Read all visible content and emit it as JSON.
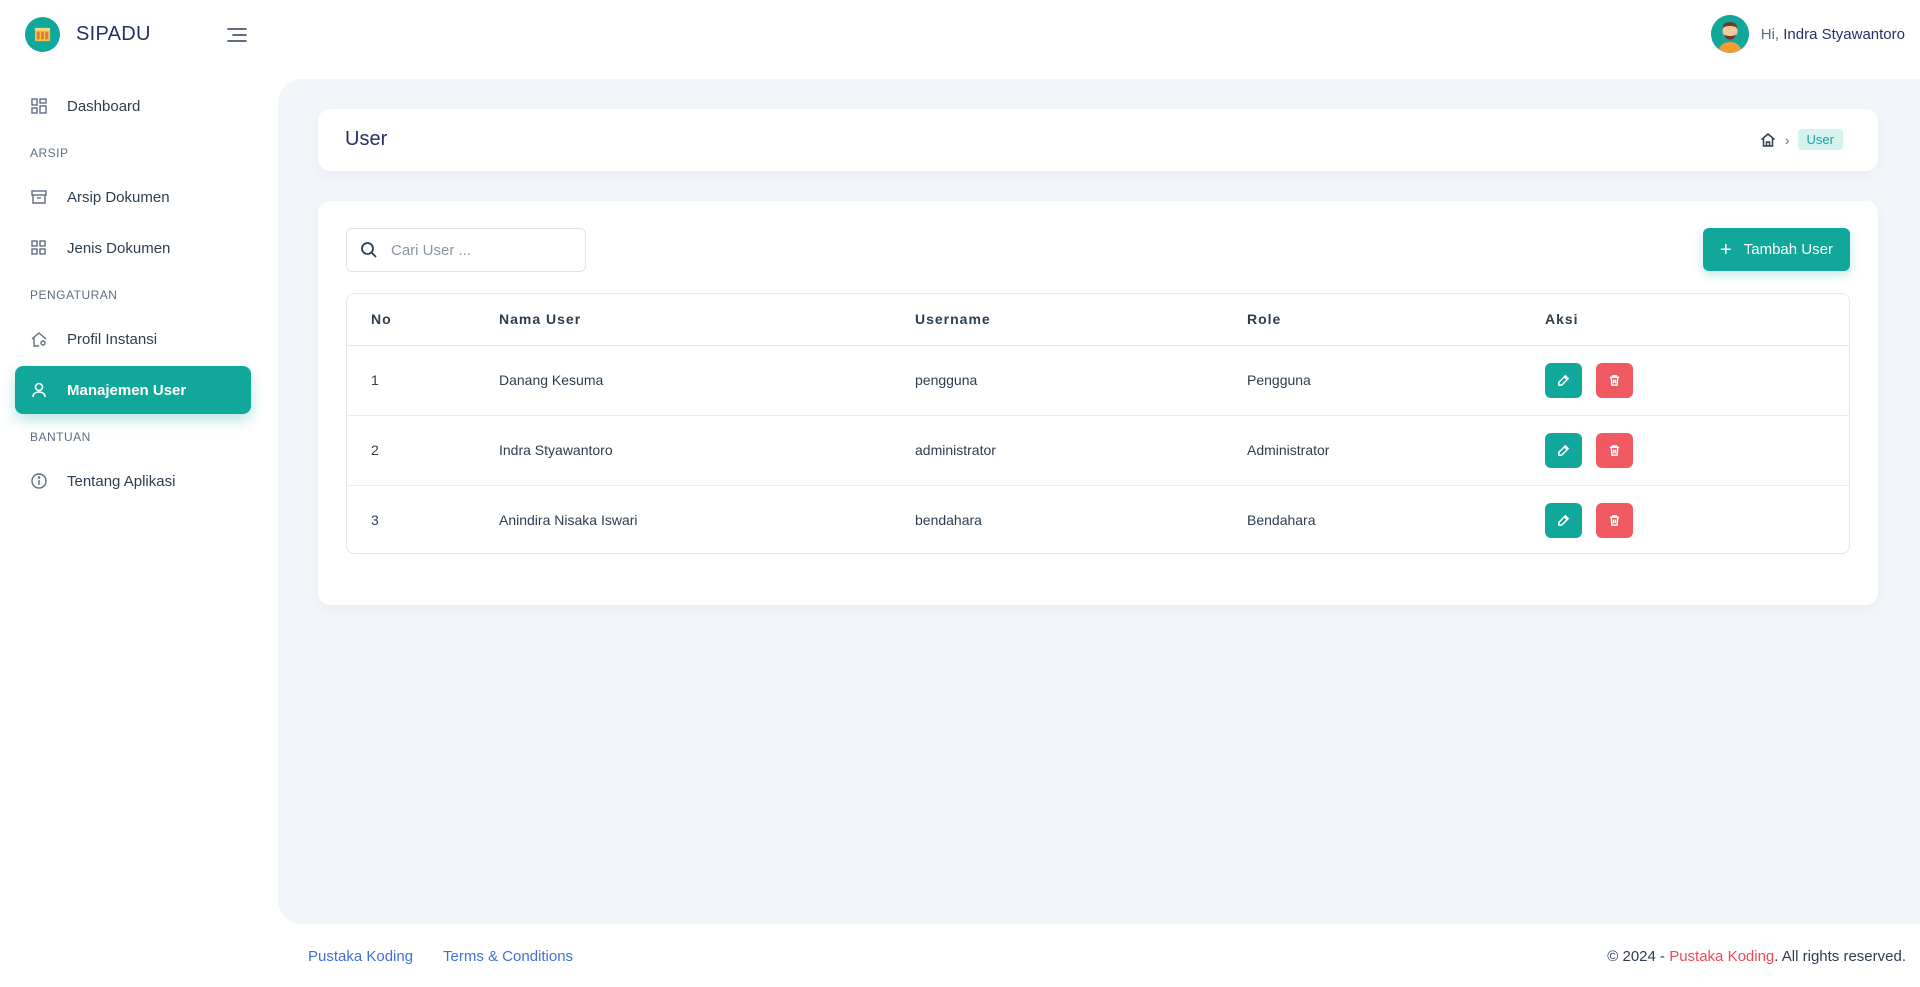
{
  "app": {
    "name": "SIPADU"
  },
  "header": {
    "greeting_prefix": "Hi,",
    "user_name": "Indra Styawantoro"
  },
  "sidebar": {
    "dashboard": "Dashboard",
    "section_arsip": "ARSIP",
    "arsip_dokumen": "Arsip Dokumen",
    "jenis_dokumen": "Jenis Dokumen",
    "section_pengaturan": "PENGATURAN",
    "profil_instansi": "Profil Instansi",
    "manajemen_user": "Manajemen User",
    "section_bantuan": "BANTUAN",
    "tentang_aplikasi": "Tentang Aplikasi"
  },
  "page": {
    "title": "User",
    "breadcrumb_active": "User"
  },
  "toolbar": {
    "search_placeholder": "Cari User ...",
    "add_label": "Tambah User",
    "add_icon": "+"
  },
  "table": {
    "headers": {
      "no": "No",
      "name": "Nama User",
      "username": "Username",
      "role": "Role",
      "aksi": "Aksi"
    },
    "rows": [
      {
        "no": "1",
        "name": "Danang Kesuma",
        "username": "pengguna",
        "role": "Pengguna"
      },
      {
        "no": "2",
        "name": "Indra Styawantoro",
        "username": "administrator",
        "role": "Administrator"
      },
      {
        "no": "3",
        "name": "Anindira Nisaka Iswari",
        "username": "bendahara",
        "role": "Bendahara"
      }
    ]
  },
  "footer": {
    "link1": "Pustaka Koding",
    "link2": "Terms & Conditions",
    "copy_prefix": "© 2024 - ",
    "copy_brand": "Pustaka Koding",
    "copy_suffix": ". All rights reserved."
  },
  "colors": {
    "primary": "#12a79b",
    "danger": "#ef5961",
    "navy": "#25306b",
    "bg": "#f2f5f9"
  }
}
